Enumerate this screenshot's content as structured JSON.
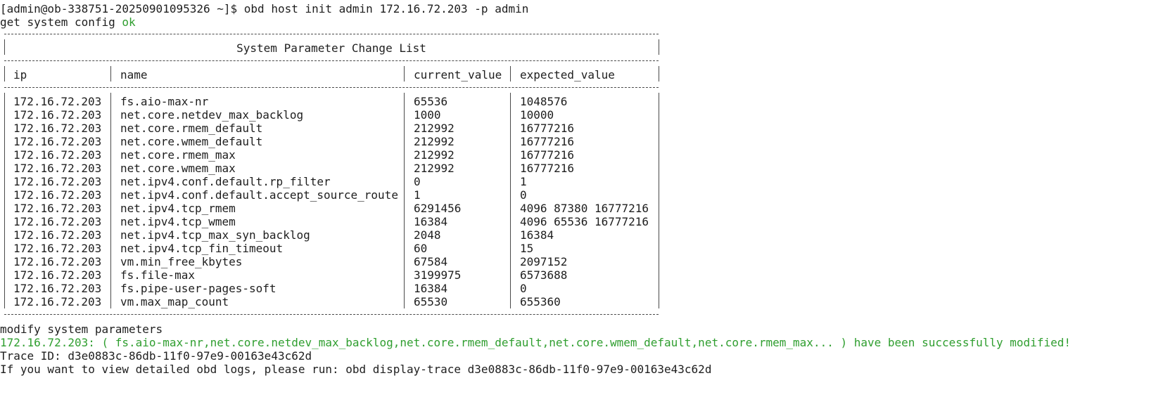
{
  "terminal": {
    "prompt_line": "[admin@ob-338751-20250901095326 ~]$ obd host init admin 172.16.72.203 -p admin",
    "get_config_label": "get system config ",
    "get_config_status": "ok",
    "table": {
      "title": "System Parameter Change List",
      "headers": [
        "ip",
        "name",
        "current_value",
        "expected_value"
      ],
      "rows": [
        [
          "172.16.72.203",
          "fs.aio-max-nr",
          "65536",
          "1048576"
        ],
        [
          "172.16.72.203",
          "net.core.netdev_max_backlog",
          "1000",
          "10000"
        ],
        [
          "172.16.72.203",
          "net.core.rmem_default",
          "212992",
          "16777216"
        ],
        [
          "172.16.72.203",
          "net.core.wmem_default",
          "212992",
          "16777216"
        ],
        [
          "172.16.72.203",
          "net.core.rmem_max",
          "212992",
          "16777216"
        ],
        [
          "172.16.72.203",
          "net.core.wmem_max",
          "212992",
          "16777216"
        ],
        [
          "172.16.72.203",
          "net.ipv4.conf.default.rp_filter",
          "0",
          "1"
        ],
        [
          "172.16.72.203",
          "net.ipv4.conf.default.accept_source_route",
          "1",
          "0"
        ],
        [
          "172.16.72.203",
          "net.ipv4.tcp_rmem",
          "6291456",
          "4096 87380 16777216"
        ],
        [
          "172.16.72.203",
          "net.ipv4.tcp_wmem",
          "16384",
          "4096 65536 16777216"
        ],
        [
          "172.16.72.203",
          "net.ipv4.tcp_max_syn_backlog",
          "2048",
          "16384"
        ],
        [
          "172.16.72.203",
          "net.ipv4.tcp_fin_timeout",
          "60",
          "15"
        ],
        [
          "172.16.72.203",
          "vm.min_free_kbytes",
          "67584",
          "2097152"
        ],
        [
          "172.16.72.203",
          "fs.file-max",
          "3199975",
          "6573688"
        ],
        [
          "172.16.72.203",
          "fs.pipe-user-pages-soft",
          "16384",
          "0"
        ],
        [
          "172.16.72.203",
          "vm.max_map_count",
          "65530",
          "655360"
        ]
      ]
    },
    "modify_line": "modify system parameters",
    "success_line": "172.16.72.203: ( fs.aio-max-nr,net.core.netdev_max_backlog,net.core.rmem_default,net.core.wmem_default,net.core.rmem_max... ) have been successfully modified!",
    "trace_line": "Trace ID: d3e0883c-86db-11f0-97e9-00163e43c62d",
    "hint_line": "If you want to view detailed obd logs, please run: obd display-trace d3e0883c-86db-11f0-97e9-00163e43c62d",
    "colors": {
      "text": "#1e1e1e",
      "ok_green": "#2f9e2f",
      "background": "#ffffff"
    }
  }
}
